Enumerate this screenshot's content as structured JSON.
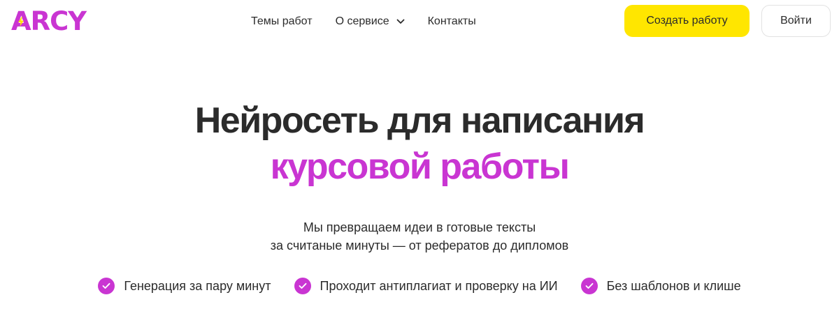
{
  "brand": {
    "logo_text": "ARCY",
    "accent_color": "#c935d2",
    "bolt_color": "#ffe600"
  },
  "nav": {
    "items": [
      {
        "label": "Темы работ"
      },
      {
        "label": "О сервисе",
        "has_dropdown": true,
        "icon": "chevron-down-icon"
      },
      {
        "label": "Контакты"
      }
    ]
  },
  "header_actions": {
    "create_label": "Создать работу",
    "create_color": "#ffe600",
    "login_label": "Войти"
  },
  "hero": {
    "title_line1": "Нейросеть для написания",
    "title_line2": "курсовой работы",
    "subtitle_line1": "Мы превращаем идеи в готовые тексты",
    "subtitle_line2": "за считаные минуты — от рефератов до дипломов"
  },
  "features": [
    {
      "label": "Генерация за пару минут",
      "icon": "check-circle-icon"
    },
    {
      "label": "Проходит антиплагиат и проверку на ИИ",
      "icon": "check-circle-icon"
    },
    {
      "label": "Без шаблонов и клише",
      "icon": "check-circle-icon"
    }
  ]
}
